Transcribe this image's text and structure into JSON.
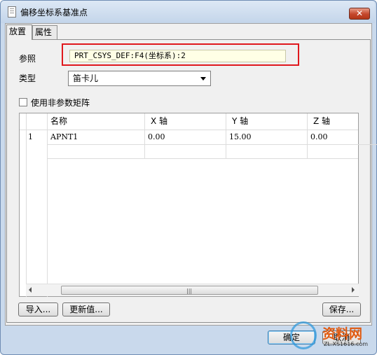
{
  "window": {
    "title": "偏移坐标系基准点",
    "close_label": "✕"
  },
  "tabs": [
    {
      "label": "放置"
    },
    {
      "label": "属性"
    }
  ],
  "form": {
    "reference_label": "参照",
    "reference_value": "PRT_CSYS_DEF:F4(坐标系):2",
    "type_label": "类型",
    "type_value": "笛卡儿",
    "checkbox_label": "使用非参数矩阵",
    "checkbox_checked": false
  },
  "table": {
    "columns": [
      "名称",
      "X 轴",
      "Y 轴",
      "Z 轴"
    ],
    "rows": [
      {
        "index": "1",
        "name": "APNT1",
        "x": "0.00",
        "y": "15.00",
        "z": "0.00"
      }
    ]
  },
  "buttons": {
    "import": "导入...",
    "update": "更新值...",
    "save": "保存...",
    "ok": "确定",
    "cancel": "取消"
  },
  "watermark": {
    "text": "资料网",
    "url": "ZL.XS1616.com"
  },
  "colors": {
    "highlight": "#e0181d",
    "title_bg": "#c3d5ea",
    "close_button": "#c4462b"
  }
}
